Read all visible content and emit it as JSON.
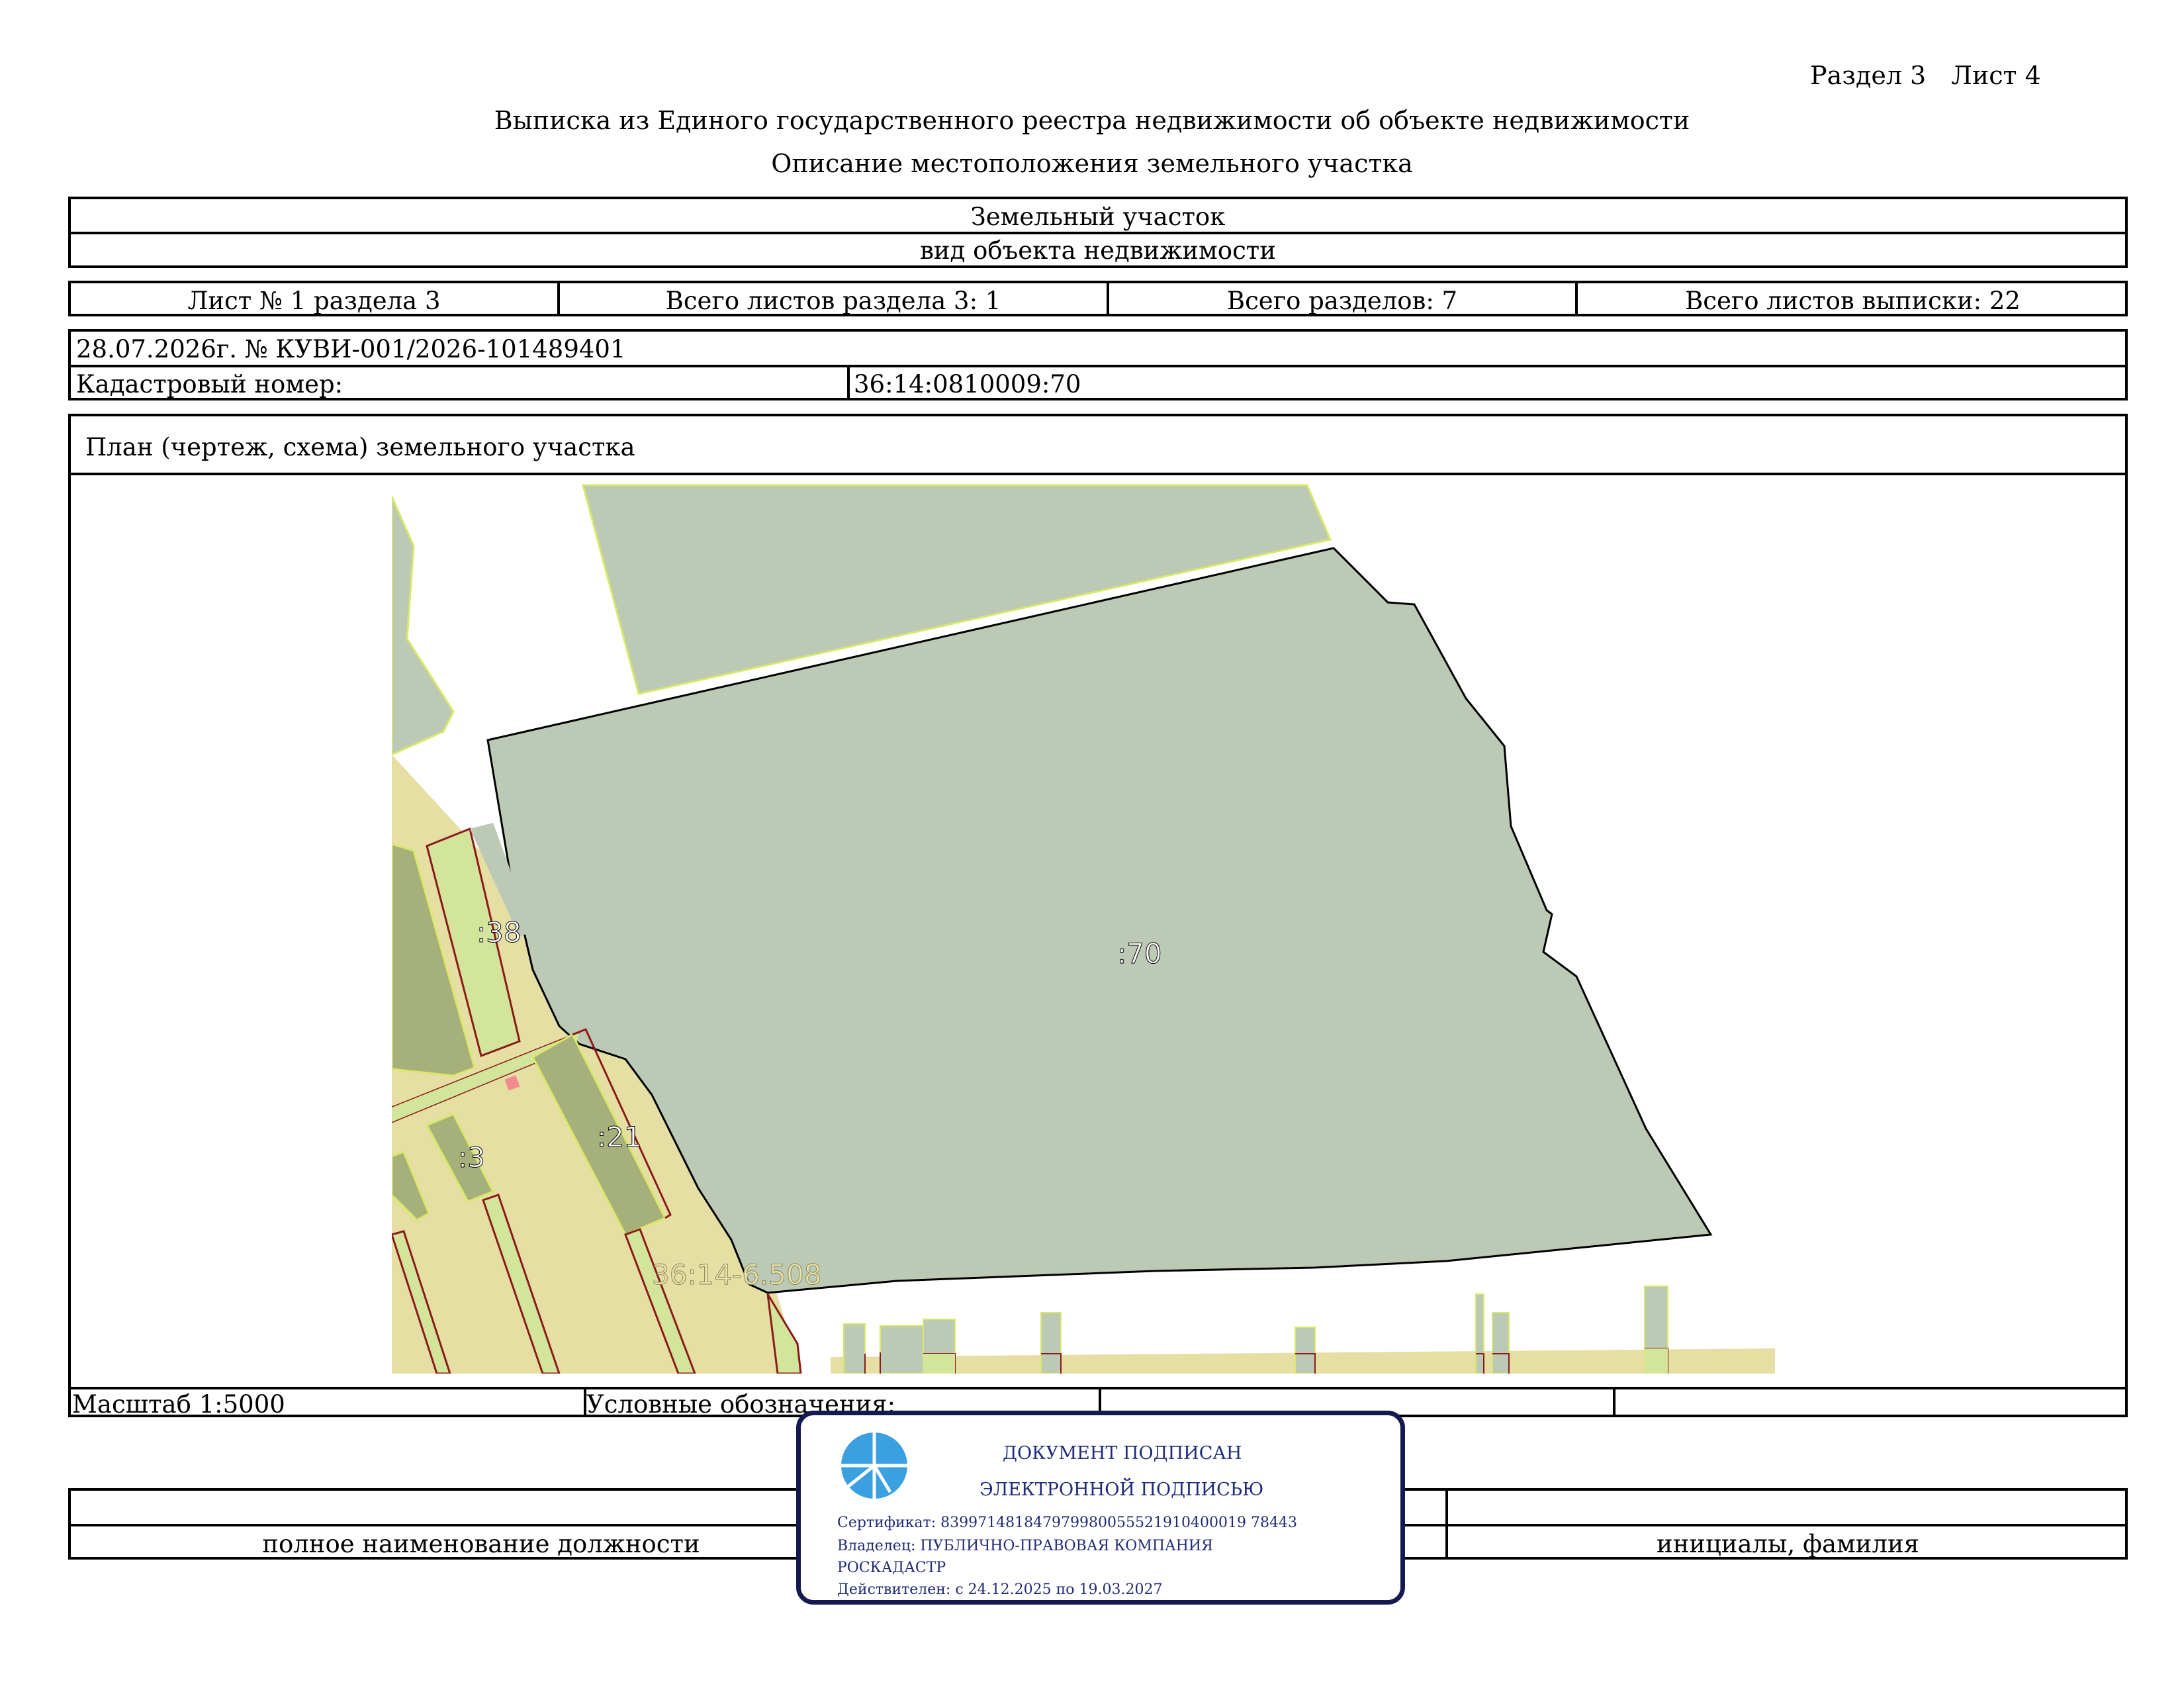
{
  "header": {
    "section": "Раздел 3",
    "sheet": "Лист 4",
    "title": "Выписка из Единого государственного реестра недвижимости об объекте недвижимости",
    "subtitle": "Описание местоположения земельного участка"
  },
  "object": {
    "name": "Земельный участок",
    "caption": "вид объекта недвижимости"
  },
  "sheets": {
    "sheet_no": "Лист № 1 раздела 3",
    "total_section_sheets": "Всего листов раздела 3: 1",
    "total_sections": "Всего разделов: 7",
    "total_extract_sheets": "Всего листов выписки: 22"
  },
  "info": {
    "date_number": "28.07.2026г. № КУВИ-001/2026-101489401",
    "cadastral_label": "Кадастровый номер:",
    "cadastral_value": "36:14:0810009:70"
  },
  "plan": {
    "title": "План (чертеж, схема) земельного участка",
    "labels": {
      "main": ":70",
      "p38": ":38",
      "p21": ":21",
      "p3": ":3",
      "zone": "36:14-6.508"
    },
    "colors": {
      "parcel_fill": "#bcc9b5",
      "zone_fill": "#e6dfa3",
      "small_parcel_fill": "#d2e59a",
      "dark_parcel_fill": "#a6b07a",
      "border_red": "#8b1a1a",
      "border_yellow": "#d9e86a",
      "zone_label": "#e9e2a6"
    }
  },
  "footer": {
    "scale": "Масштаб 1:5000",
    "legend": "Условные обозначения:",
    "position_caption": "полное наименование должности",
    "name_caption": "инициалы, фамилия"
  },
  "stamp": {
    "line1": "ДОКУМЕНТ ПОДПИСАН",
    "line2": "ЭЛЕКТРОННОЙ ПОДПИСЬЮ",
    "certificate": "Сертификат: 839971481847979980055521910400019 78443",
    "owner": "Владелец: ПУБЛИЧНО-ПРАВОВАЯ КОМПАНИЯ",
    "owner2": "РОСКАДАСТР",
    "valid": "Действителен: с 24.12.2025 по 19.03.2027",
    "color": "#1f2a78"
  }
}
